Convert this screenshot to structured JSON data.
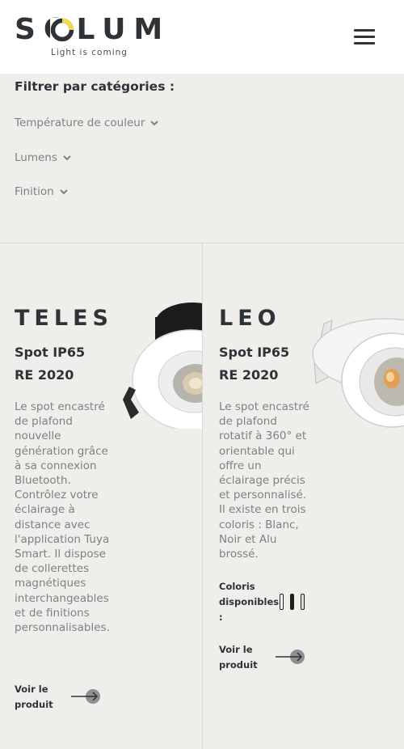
{
  "header": {
    "logo_word": "SOLUM",
    "logo_tagline": "Light is coming",
    "menu_label": "menu",
    "accent_color": "#f2d94e"
  },
  "filters": {
    "title": "Filtrer par catégories :",
    "items": [
      {
        "label": "Température de couleur"
      },
      {
        "label": "Lumens"
      },
      {
        "label": "Finition"
      }
    ]
  },
  "products": [
    {
      "name": "TELES",
      "subtitle_line1": "Spot IP65",
      "subtitle_line2": "RE 2020",
      "description": "Le spot encastré de plafond nouvelle génération grâce à sa connexion Bluetooth. Contrôlez votre éclairage à distance avec l'application Tuya Smart. Il dispose de collerettes magnétiques interchangeables et de finitions personnalisables.",
      "cta_line1": "Voir le",
      "cta_line2": "produit"
    },
    {
      "name": "LEO",
      "subtitle_line1": "Spot IP65",
      "subtitle_line2": "RE 2020",
      "description": "Le spot encastré de plafond rotatif à 360° et orientable qui offre un éclairage précis et personnalisé. Il existe en trois coloris : Blanc, Noir et Alu brossé.",
      "coloris_line1": "Coloris",
      "coloris_line2": "disponibles",
      "coloris_line3": ":",
      "colors": [
        "#ffffff",
        "#1e1e1e",
        "#d6d6d6"
      ],
      "cta_line1": "Voir le",
      "cta_line2": "produit"
    }
  ]
}
